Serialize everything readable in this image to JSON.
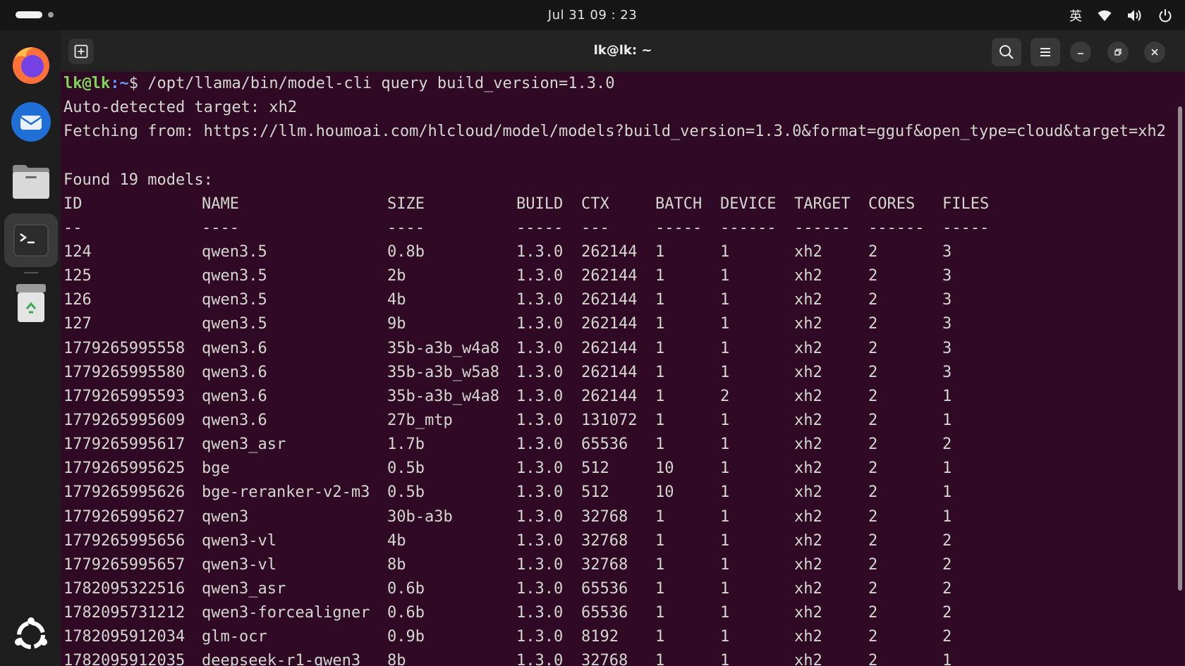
{
  "topbar": {
    "clock": "Jul 31  09 : 23",
    "input_method": "英",
    "icons": [
      "wifi-icon",
      "volume-icon",
      "power-icon"
    ]
  },
  "dock": {
    "apps": [
      "firefox-icon",
      "thunderbird-icon",
      "files-icon",
      "terminal-icon",
      "trash-icon",
      "ubuntu-apps-icon"
    ],
    "active": "terminal-icon"
  },
  "window": {
    "title": "lk@lk: ~"
  },
  "terminal": {
    "prompt_user": "lk@lk",
    "prompt_path": ":~",
    "prompt_symbol": "$ ",
    "command": "/opt/llama/bin/model-cli query build_version=1.3.0",
    "output_lines": [
      "Auto-detected target: xh2",
      "Fetching from: https://llm.houmoai.com/hlcloud/model/models?build_version=1.3.0&format=gguf&open_type=cloud&target=xh2",
      "",
      "Found 19 models:"
    ],
    "columns": [
      "ID",
      "NAME",
      "SIZE",
      "BUILD",
      "CTX",
      "BATCH",
      "DEVICE",
      "TARGET",
      "CORES",
      "FILES"
    ],
    "separators": [
      "--",
      "----",
      "----",
      "-----",
      "---",
      "-----",
      "------",
      "------",
      "------",
      "-----"
    ],
    "rows": [
      [
        "124",
        "qwen3.5",
        "0.8b",
        "1.3.0",
        "262144",
        "1",
        "1",
        "xh2",
        "2",
        "3"
      ],
      [
        "125",
        "qwen3.5",
        "2b",
        "1.3.0",
        "262144",
        "1",
        "1",
        "xh2",
        "2",
        "3"
      ],
      [
        "126",
        "qwen3.5",
        "4b",
        "1.3.0",
        "262144",
        "1",
        "1",
        "xh2",
        "2",
        "3"
      ],
      [
        "127",
        "qwen3.5",
        "9b",
        "1.3.0",
        "262144",
        "1",
        "1",
        "xh2",
        "2",
        "3"
      ],
      [
        "1779265995558",
        "qwen3.6",
        "35b-a3b_w4a8",
        "1.3.0",
        "262144",
        "1",
        "1",
        "xh2",
        "2",
        "3"
      ],
      [
        "1779265995580",
        "qwen3.6",
        "35b-a3b_w5a8",
        "1.3.0",
        "262144",
        "1",
        "1",
        "xh2",
        "2",
        "3"
      ],
      [
        "1779265995593",
        "qwen3.6",
        "35b-a3b_w4a8",
        "1.3.0",
        "262144",
        "1",
        "2",
        "xh2",
        "2",
        "1"
      ],
      [
        "1779265995609",
        "qwen3.6",
        "27b_mtp",
        "1.3.0",
        "131072",
        "1",
        "1",
        "xh2",
        "2",
        "1"
      ],
      [
        "1779265995617",
        "qwen3_asr",
        "1.7b",
        "1.3.0",
        "65536",
        "1",
        "1",
        "xh2",
        "2",
        "2"
      ],
      [
        "1779265995625",
        "bge",
        "0.5b",
        "1.3.0",
        "512",
        "10",
        "1",
        "xh2",
        "2",
        "1"
      ],
      [
        "1779265995626",
        "bge-reranker-v2-m3",
        "0.5b",
        "1.3.0",
        "512",
        "10",
        "1",
        "xh2",
        "2",
        "1"
      ],
      [
        "1779265995627",
        "qwen3",
        "30b-a3b",
        "1.3.0",
        "32768",
        "1",
        "1",
        "xh2",
        "2",
        "1"
      ],
      [
        "1779265995656",
        "qwen3-vl",
        "4b",
        "1.3.0",
        "32768",
        "1",
        "1",
        "xh2",
        "2",
        "2"
      ],
      [
        "1779265995657",
        "qwen3-vl",
        "8b",
        "1.3.0",
        "32768",
        "1",
        "1",
        "xh2",
        "2",
        "2"
      ],
      [
        "1782095322516",
        "qwen3_asr",
        "0.6b",
        "1.3.0",
        "65536",
        "1",
        "1",
        "xh2",
        "2",
        "2"
      ],
      [
        "1782095731212",
        "qwen3-forcealigner",
        "0.6b",
        "1.3.0",
        "65536",
        "1",
        "1",
        "xh2",
        "2",
        "2"
      ],
      [
        "1782095912034",
        "glm-ocr",
        "0.9b",
        "1.3.0",
        "8192",
        "1",
        "1",
        "xh2",
        "2",
        "2"
      ],
      [
        "1782095912035",
        "deepseek-r1-qwen3",
        "8b",
        "1.3.0",
        "32768",
        "1",
        "1",
        "xh2",
        "2",
        "1"
      ]
    ]
  },
  "colors": {
    "terminal_bg": "#300a24",
    "prompt_user": "#7fd65a",
    "prompt_path": "#6a9cff",
    "text": "#d3d7cf",
    "running_indicator": "#e95420"
  }
}
